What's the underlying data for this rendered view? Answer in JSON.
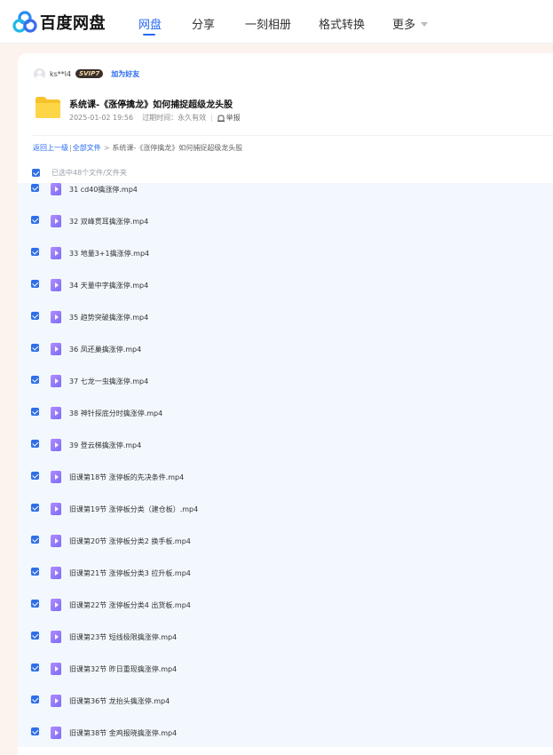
{
  "header": {
    "logo_text": "百度网盘",
    "nav": [
      {
        "label": "网盘",
        "active": true
      },
      {
        "label": "分享",
        "active": false
      },
      {
        "label": "一刻相册",
        "active": false
      },
      {
        "label": "格式转换",
        "active": false
      },
      {
        "label": "更多",
        "active": false
      }
    ],
    "colors": {
      "accent": "#2468f2",
      "background": "#fdf3ee"
    }
  },
  "share": {
    "username": "ks**l4",
    "vip_badge": "SVIP7",
    "add_friend": "加为好友",
    "folder_title": "系统课-《涨停擒龙》如何捕捉超级龙头股",
    "date": "2025-01-02 19:56",
    "expire": "过期时间：永久有效",
    "report": "举报"
  },
  "breadcrumb": {
    "back": "返回上一级",
    "all_files": "全部文件",
    "current": "系统课-《涨停擒龙》如何捕捉超级龙头股"
  },
  "selection": {
    "label": "已选中48个文件/文件夹",
    "all_checked": true
  },
  "files": [
    {
      "name": "31 cd40擒涨停.mp4",
      "checked": true,
      "icon": "video-icon"
    },
    {
      "name": "32 双峰贯耳擒涨停.mp4",
      "checked": true,
      "icon": "video-icon"
    },
    {
      "name": "33 地量3+1擒涨停.mp4",
      "checked": true,
      "icon": "video-icon"
    },
    {
      "name": "34 天量中字擒涨停.mp4",
      "checked": true,
      "icon": "video-icon"
    },
    {
      "name": "35 趋势突破擒涨停.mp4",
      "checked": true,
      "icon": "video-icon"
    },
    {
      "name": "36 凤还巢擒涨停.mp4",
      "checked": true,
      "icon": "video-icon"
    },
    {
      "name": "37 七龙一虫擒涨停.mp4",
      "checked": true,
      "icon": "video-icon"
    },
    {
      "name": "38 神针探底分时擒涨停.mp4",
      "checked": true,
      "icon": "video-icon"
    },
    {
      "name": "39 登云梯擒涨停.mp4",
      "checked": true,
      "icon": "video-icon"
    },
    {
      "name": "旧课第18节 涨停板的先决条件.mp4",
      "checked": true,
      "icon": "video-icon"
    },
    {
      "name": "旧课第19节 涨停板分类（建仓板）.mp4",
      "checked": true,
      "icon": "video-icon"
    },
    {
      "name": "旧课第20节 涨停板分类2 换手板.mp4",
      "checked": true,
      "icon": "video-icon"
    },
    {
      "name": "旧课第21节 涨停板分类3 拉升板.mp4",
      "checked": true,
      "icon": "video-icon"
    },
    {
      "name": "旧课第22节 涨停板分类4 出货板.mp4",
      "checked": true,
      "icon": "video-icon"
    },
    {
      "name": "旧课第23节 短线极限擒涨停.mp4",
      "checked": true,
      "icon": "video-icon"
    },
    {
      "name": "旧课第32节 昨日重现擒涨停.mp4",
      "checked": true,
      "icon": "video-icon"
    },
    {
      "name": "旧课第36节 龙抬头擒涨停.mp4",
      "checked": true,
      "icon": "video-icon"
    },
    {
      "name": "旧课第38节 金鸡报晓擒涨停.mp4",
      "checked": true,
      "icon": "video-icon"
    }
  ]
}
